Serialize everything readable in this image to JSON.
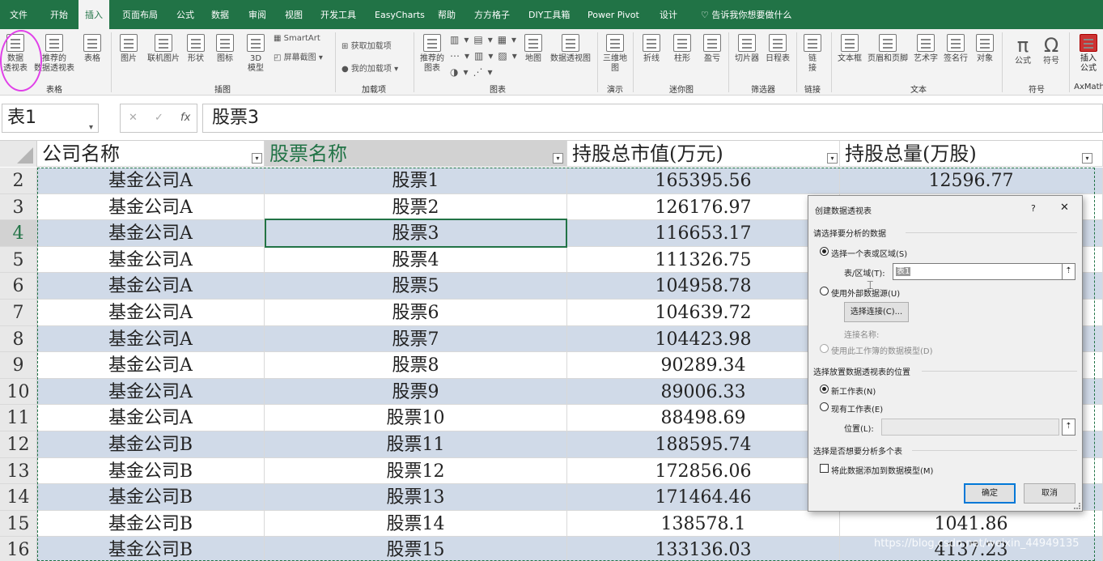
{
  "menu": {
    "tabs": [
      "文件",
      "开始",
      "插入",
      "页面布局",
      "公式",
      "数据",
      "审阅",
      "视图",
      "开发工具",
      "EasyCharts",
      "帮助",
      "方方格子",
      "DIY工具箱",
      "Power Pivot",
      "设计"
    ],
    "active": "插入",
    "tell_me": "告诉我你想要做什么"
  },
  "ribbon": {
    "pivot": "数据\n透视表",
    "rec_pivot": "推荐的\n数据透视表",
    "table": "表格",
    "group_tables": "表格",
    "picture": "图片",
    "online_picture": "联机图片",
    "shapes": "形状",
    "icons": "图标",
    "models": "3D\n模型",
    "smartart": "SmartArt",
    "screenshot": "屏幕截图",
    "group_illustrations": "插图",
    "get_addins": "获取加载项",
    "my_addins": "我的加载项",
    "group_addins": "加载项",
    "rec_charts": "推荐的\n图表",
    "map": "地图",
    "pivotchart": "数据透视图",
    "group_charts": "图表",
    "map3d": "三维地\n图",
    "group_tours": "演示",
    "line": "折线",
    "column": "柱形",
    "winloss": "盈亏",
    "group_sparklines": "迷你图",
    "slicer": "切片器",
    "timeline": "日程表",
    "group_filters": "筛选器",
    "link": "链\n接",
    "group_links": "链接",
    "textbox": "文本框",
    "header_footer": "页眉和页脚",
    "wordart": "艺术字",
    "signature": "签名行",
    "object": "对象",
    "group_text": "文本",
    "equation": "公式",
    "symbol": "符号",
    "group_symbols": "符号",
    "insert_formula": "插入\n公式",
    "axmath": "AxMath"
  },
  "formula_bar": {
    "name_box": "表1",
    "formula": "股票3"
  },
  "sheet": {
    "headers": [
      "公司名称",
      "股票名称",
      "持股总市值(万元)",
      "持股总量(万股)"
    ],
    "rows": [
      {
        "n": "2",
        "company": "基金公司A",
        "stock": "股票1",
        "value": "165395.56",
        "qty": "12596.77"
      },
      {
        "n": "3",
        "company": "基金公司A",
        "stock": "股票2",
        "value": "126176.97",
        "qty": ""
      },
      {
        "n": "4",
        "company": "基金公司A",
        "stock": "股票3",
        "value": "116653.17",
        "qty": ""
      },
      {
        "n": "5",
        "company": "基金公司A",
        "stock": "股票4",
        "value": "111326.75",
        "qty": ""
      },
      {
        "n": "6",
        "company": "基金公司A",
        "stock": "股票5",
        "value": "104958.78",
        "qty": ""
      },
      {
        "n": "7",
        "company": "基金公司A",
        "stock": "股票6",
        "value": "104639.72",
        "qty": ""
      },
      {
        "n": "8",
        "company": "基金公司A",
        "stock": "股票7",
        "value": "104423.98",
        "qty": ""
      },
      {
        "n": "9",
        "company": "基金公司A",
        "stock": "股票8",
        "value": "90289.34",
        "qty": ""
      },
      {
        "n": "10",
        "company": "基金公司A",
        "stock": "股票9",
        "value": "89006.33",
        "qty": ""
      },
      {
        "n": "11",
        "company": "基金公司A",
        "stock": "股票10",
        "value": "88498.69",
        "qty": ""
      },
      {
        "n": "12",
        "company": "基金公司B",
        "stock": "股票11",
        "value": "188595.74",
        "qty": ""
      },
      {
        "n": "13",
        "company": "基金公司B",
        "stock": "股票12",
        "value": "172856.06",
        "qty": ""
      },
      {
        "n": "14",
        "company": "基金公司B",
        "stock": "股票13",
        "value": "171464.46",
        "qty": ""
      },
      {
        "n": "15",
        "company": "基金公司B",
        "stock": "股票14",
        "value": "138578.1",
        "qty": "1041.86"
      },
      {
        "n": "16",
        "company": "基金公司B",
        "stock": "股票15",
        "value": "133136.03",
        "qty": "4137.23"
      }
    ]
  },
  "dialog": {
    "title": "创建数据透视表",
    "help": "?",
    "close": "✕",
    "section_choose": "请选择要分析的数据",
    "opt_range": "选择一个表或区域(S)",
    "range_label": "表/区域(T):",
    "range_value": "表1",
    "opt_external": "使用外部数据源(U)",
    "choose_conn": "选择连接(C)...",
    "conn_name": "连接名称:",
    "opt_model": "使用此工作簿的数据模型(D)",
    "section_place": "选择放置数据透视表的位置",
    "opt_new": "新工作表(N)",
    "opt_existing": "现有工作表(E)",
    "location_label": "位置(L):",
    "section_multi": "选择是否想要分析多个表",
    "add_model": "将此数据添加到数据模型(M)",
    "ok": "确定",
    "cancel": "取消"
  },
  "watermark": "https://blog.csdn.net/weixin_44949135"
}
